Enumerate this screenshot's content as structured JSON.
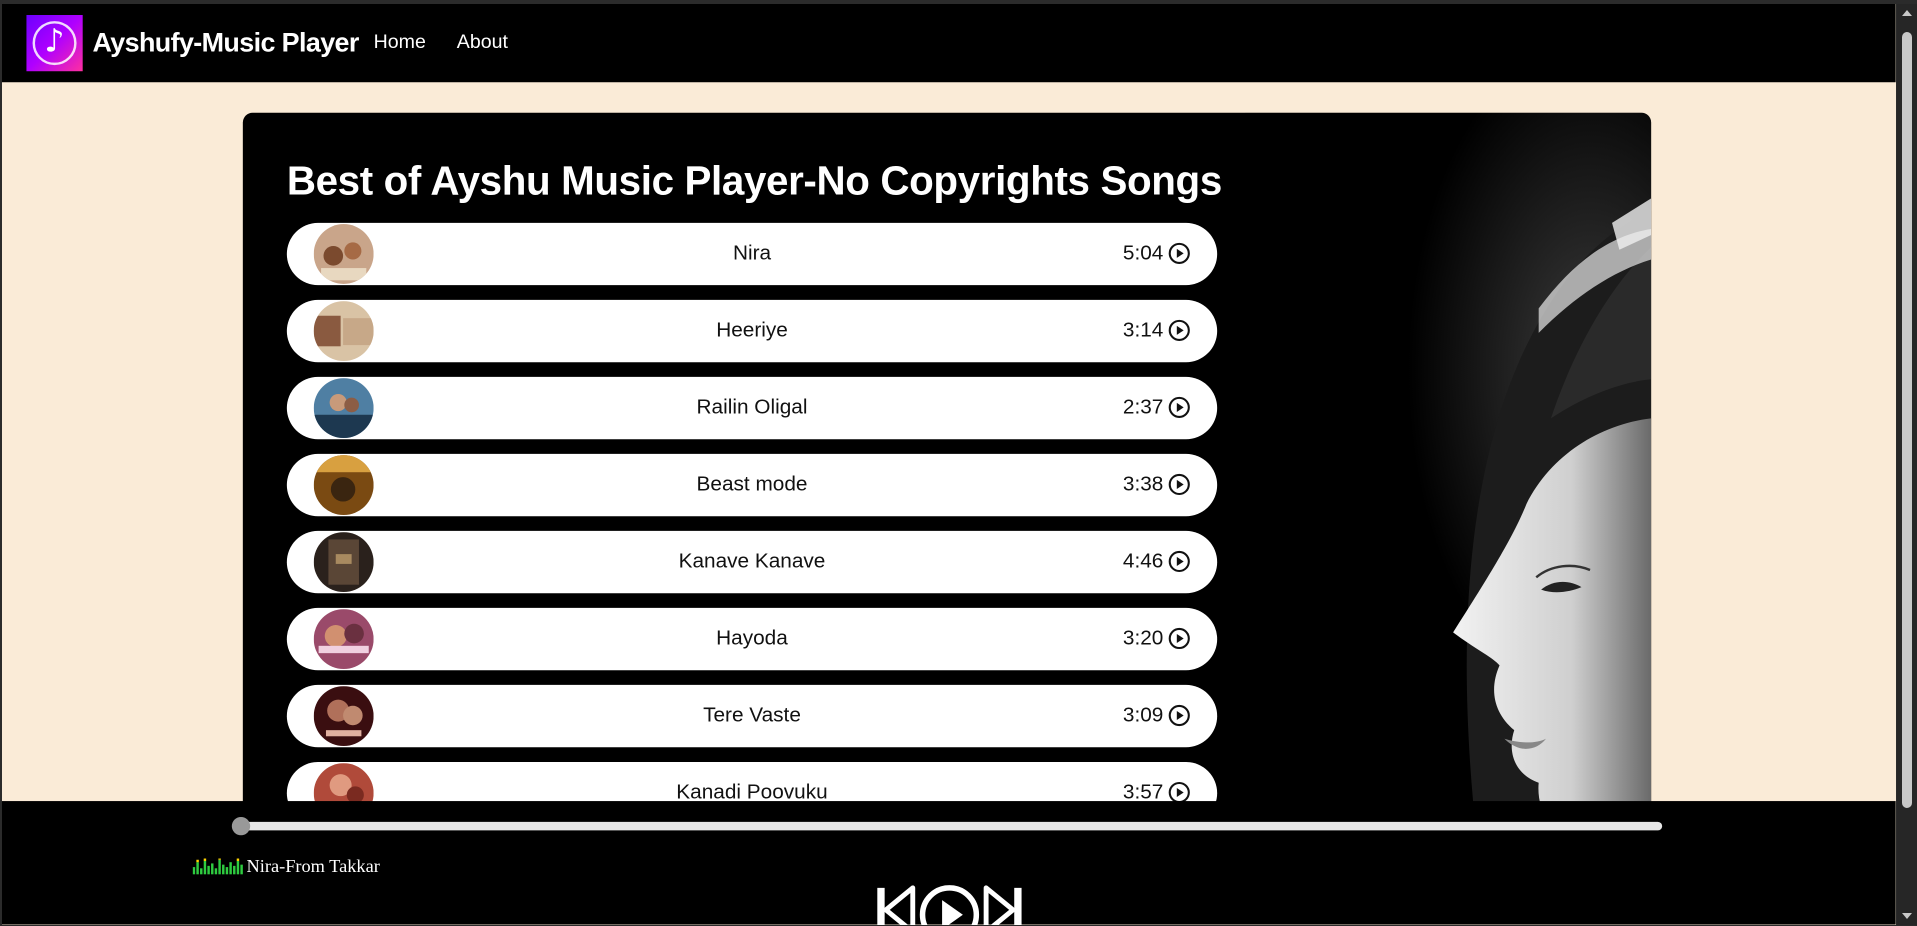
{
  "app": {
    "brand_name": "Ayshufy-Music Player",
    "nav": [
      {
        "label": "Home"
      },
      {
        "label": "About"
      }
    ]
  },
  "playlist": {
    "title": "Best of Ayshu Music Player-No Copyrights Songs",
    "songs": [
      {
        "name": "Nira",
        "duration": "5:04"
      },
      {
        "name": "Heeriye",
        "duration": "3:14"
      },
      {
        "name": "Railin Oligal",
        "duration": "2:37"
      },
      {
        "name": "Beast mode",
        "duration": "3:38"
      },
      {
        "name": "Kanave Kanave",
        "duration": "4:46"
      },
      {
        "name": "Hayoda",
        "duration": "3:20"
      },
      {
        "name": "Tere Vaste",
        "duration": "3:09"
      },
      {
        "name": "Kanadi Poovuku",
        "duration": "3:57"
      }
    ]
  },
  "player": {
    "now_playing": "Nira-From Takkar",
    "progress": 0.0,
    "controls": [
      "previous-icon",
      "play-icon",
      "next-icon"
    ]
  },
  "colors": {
    "page_background": "#faebd7",
    "navbar": "#000000",
    "row": "#ffffff",
    "equalizer": "#2ecc40"
  }
}
